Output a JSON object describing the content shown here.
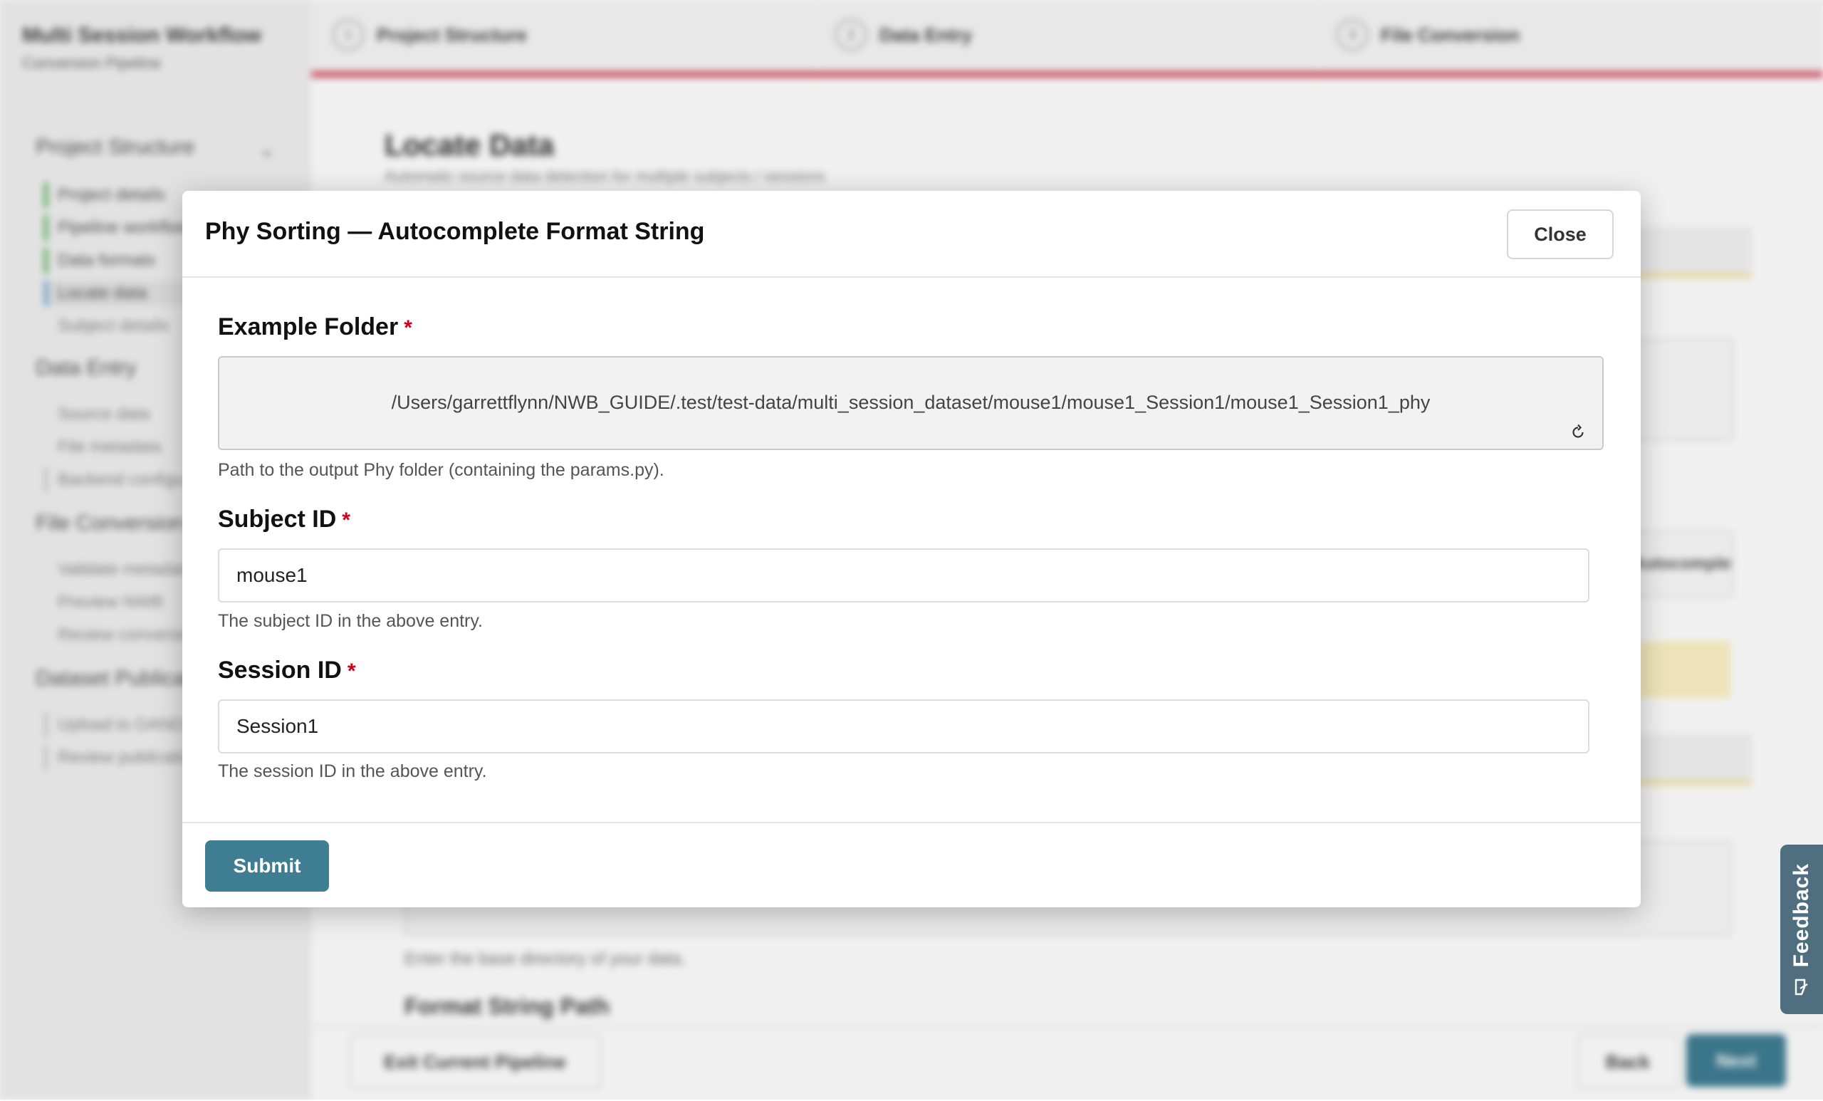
{
  "background": {
    "sidebar": {
      "title": "Multi Session Workflow",
      "subtitle": "Conversion Pipeline",
      "sections": [
        {
          "label": "Project Structure",
          "items": [
            "Project details",
            "Pipeline workflow",
            "Data formats",
            "Locate data",
            "Subject details"
          ]
        },
        {
          "label": "Data Entry",
          "items": [
            "Source data",
            "File metadata",
            "Backend configuration"
          ]
        },
        {
          "label": "File Conversion",
          "items": [
            "Validate metadata",
            "Preview NWB",
            "Review conversion"
          ]
        },
        {
          "label": "Dataset Publication",
          "items": [
            "Upload to DANDI",
            "Review publication"
          ]
        }
      ]
    },
    "steps": [
      {
        "num": "1",
        "label": "Project Structure"
      },
      {
        "num": "2",
        "label": "Data Entry"
      },
      {
        "num": "3",
        "label": "File Conversion"
      }
    ],
    "main": {
      "title": "Locate Data",
      "subtitle": "Automatic source data detection for multiple subjects / sessions",
      "autocomplete_label": "Autocomplete",
      "base_dir_help": "Enter the base directory of your data.",
      "format_string_label": "Format String Path"
    },
    "footer": {
      "exit_label": "Exit Current Pipeline",
      "back_label": "Back",
      "next_label": "Next"
    }
  },
  "feedback": {
    "label": "Feedback"
  },
  "modal": {
    "title": "Phy Sorting — Autocomplete Format String",
    "close_label": "Close",
    "fields": {
      "example_folder": {
        "label": "Example Folder",
        "required_mark": "*",
        "value": "/Users/garrettflynn/NWB_GUIDE/.test/test-data/multi_session_dataset/mouse1/mouse1_Session1/mouse1_Session1_phy",
        "help": "Path to the output Phy folder (containing the params.py)."
      },
      "subject_id": {
        "label": "Subject ID",
        "required_mark": "*",
        "value": "mouse1",
        "help": "The subject ID in the above entry."
      },
      "session_id": {
        "label": "Session ID",
        "required_mark": "*",
        "value": "Session1",
        "help": "The session ID in the above entry."
      }
    },
    "submit_label": "Submit"
  },
  "colors": {
    "accent": "#3f7d93",
    "progress_bar": "#d8576b",
    "required": "#d0021b",
    "feedback_tab": "#4f6f80"
  }
}
